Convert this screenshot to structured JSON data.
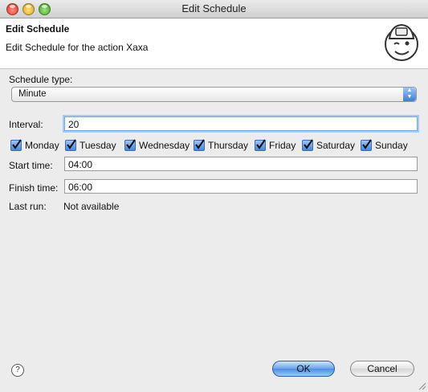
{
  "window": {
    "title": "Edit Schedule"
  },
  "header": {
    "title": "Edit Schedule",
    "description": "Edit Schedule for the action Xaxa"
  },
  "form": {
    "schedule_type_label": "Schedule type:",
    "schedule_type_value": "Minute",
    "interval_label": "Interval:",
    "interval_value": "20",
    "days": [
      {
        "label": "Monday",
        "checked": true
      },
      {
        "label": "Tuesday",
        "checked": true
      },
      {
        "label": "Wednesday",
        "checked": true
      },
      {
        "label": "Thursday",
        "checked": true
      },
      {
        "label": "Friday",
        "checked": true
      },
      {
        "label": "Saturday",
        "checked": true
      },
      {
        "label": "Sunday",
        "checked": true
      }
    ],
    "start_time_label": "Start time:",
    "start_time_value": "04:00",
    "finish_time_label": "Finish time:",
    "finish_time_value": "06:00",
    "last_run_label": "Last run:",
    "last_run_value": "Not available"
  },
  "footer": {
    "help_icon": "?",
    "ok_label": "OK",
    "cancel_label": "Cancel"
  },
  "colors": {
    "accent": "#4c8de3",
    "focus_ring": "#a9c8f2"
  }
}
